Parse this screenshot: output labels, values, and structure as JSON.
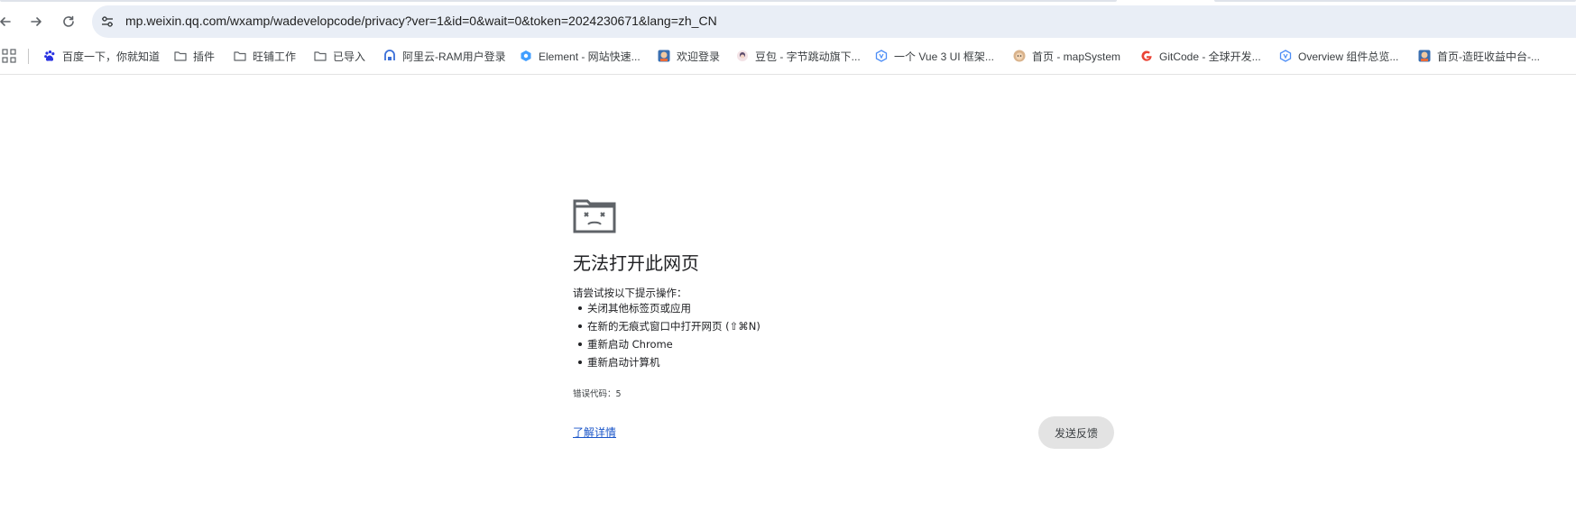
{
  "browser": {
    "url": "mp.weixin.qq.com/wxamp/wadevelopcode/privacy?ver=1&id=0&wait=0&token=2024230671&lang=zh_CN",
    "icons": {
      "back": "back-arrow-icon",
      "forward": "forward-arrow-icon",
      "reload": "reload-icon",
      "site_info": "tune-icon"
    }
  },
  "bookmarks": [
    {
      "label": "百度一下，你就知道",
      "icon": "baidu-paw-icon"
    },
    {
      "label": "插件",
      "icon": "folder-icon"
    },
    {
      "label": "旺铺工作",
      "icon": "folder-icon"
    },
    {
      "label": "已导入",
      "icon": "folder-icon"
    },
    {
      "label": "阿里云-RAM用户登录",
      "icon": "aliyun-icon"
    },
    {
      "label": "Element - 网站快速...",
      "icon": "element-icon"
    },
    {
      "label": "欢迎登录",
      "icon": "avatar-icon"
    },
    {
      "label": "豆包 - 字节跳动旗下...",
      "icon": "doubao-icon"
    },
    {
      "label": "一个 Vue 3 UI 框架...",
      "icon": "vue-ui-icon"
    },
    {
      "label": "首页 - mapSystem",
      "icon": "avatar-icon"
    },
    {
      "label": "GitCode - 全球开发...",
      "icon": "google-g-icon"
    },
    {
      "label": "Overview 组件总览...",
      "icon": "vue-ui-icon"
    },
    {
      "label": "首页-造旺收益中台-...",
      "icon": "avatar-icon"
    }
  ],
  "error_page": {
    "title": "无法打开此网页",
    "suggestion_intro": "请尝试按以下提示操作：",
    "suggestions": [
      "关闭其他标签页或应用",
      "在新的无痕式窗口中打开网页 (⇧⌘N)",
      "重新启动 Chrome",
      "重新启动计算机"
    ],
    "error_code": "错误代码：5",
    "learn_more": "了解详情",
    "feedback": "发送反馈",
    "icon": "sad-folder-icon"
  }
}
